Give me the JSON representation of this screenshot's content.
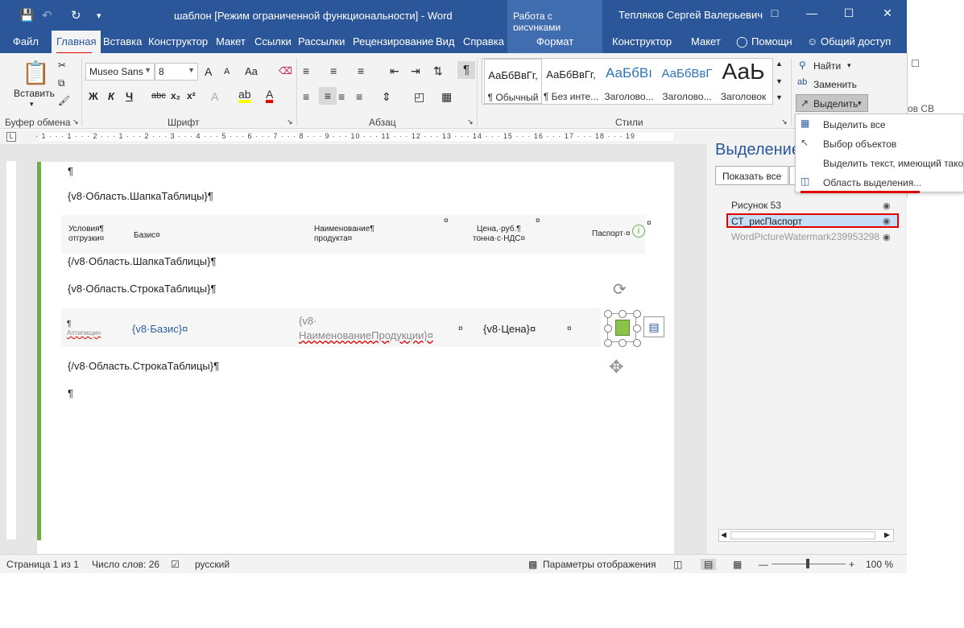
{
  "titlebar": {
    "save_icon": "save-icon",
    "title": "шаблон [Режим ограниченной функциональности]  -  Word",
    "context_header": "Работа с рисунками",
    "user": "Тепляков Сергей Валерьевич"
  },
  "tabs": {
    "file": "Файл",
    "home": "Главная",
    "insert": "Вставка",
    "design": "Конструктор",
    "layout": "Макет",
    "references": "Ссылки",
    "mailings": "Рассылки",
    "review": "Рецензирование",
    "view": "Вид",
    "help": "Справка",
    "format": "Формат",
    "design2": "Конструктор",
    "layout2": "Макет",
    "tellme": "Помощн",
    "share": "Общий доступ"
  },
  "ribbon": {
    "clipboard": {
      "paste": "Вставить",
      "label": "Буфер обмена"
    },
    "font": {
      "family": "Museo Sans",
      "size": "8",
      "bold": "Ж",
      "italic": "К",
      "underline": "Ч",
      "strike": "abc",
      "sub": "x₂",
      "sup": "x²",
      "grow": "A",
      "shrink": "A",
      "case": "Aa",
      "label": "Шрифт"
    },
    "paragraph": {
      "label": "Абзац"
    },
    "styles": {
      "items": [
        {
          "preview": "АаБбВвГг,",
          "name": "¶ Обычный"
        },
        {
          "preview": "АаБбВвГг,",
          "name": "¶ Без инте..."
        },
        {
          "preview": "АаБбВı",
          "name": "Заголово..."
        },
        {
          "preview": "АаБбВвГ",
          "name": "Заголово..."
        },
        {
          "preview": "АаЬ",
          "name": "Заголовок"
        }
      ],
      "label": "Стили"
    },
    "editing": {
      "find": "Найти",
      "replace": "Заменить",
      "select": "Выделить"
    }
  },
  "select_menu": {
    "items": [
      {
        "label": "Выделить все"
      },
      {
        "label": "Выбор объектов"
      },
      {
        "label": "Выделить текст, имеющий тако"
      },
      {
        "label": "Область выделения..."
      }
    ]
  },
  "ruler": {
    "marks": "· 1 · · · 1 · · · 2 · · · 1 · · · 2 · · · 3 · · · 4 · · · 5 · · · 6 · · · 7 · · · 8 · · · 9 · · · 10 · · · 11 · · · 12 · · · 13 · · · 14 · · · 15 · · · 16 · · · 17 · · · 18 · · · 19"
  },
  "document": {
    "para1": "¶",
    "header_open": "{v8·Область.ШапкаТаблицы}¶",
    "col1": "Условия¶",
    "col1b": "отгрузки¤",
    "col2": "Базис¤",
    "col3": "Наименование¶",
    "col3b": "продукта¤",
    "col4": "Цена,·руб.¶",
    "col4b": "тонна·с·НДС¤",
    "col5": "Паспорт·¤",
    "header_close": "{/v8·Область.ШапкаТаблицы}¶",
    "row_open": "{v8·Область.СтрокаТаблицы}¶",
    "cell1": "¶",
    "cell1b": "Аптипищин",
    "cell2": "{v8·Базис}¤",
    "cell3": "{v8·",
    "cell3b": "НаименованиеПродукции}¤",
    "cell3c": "¤",
    "cell4": "{v8·Цена}¤",
    "cell4b": "¤",
    "row_close": "{/v8·Область.СтрокаТаблицы}¶",
    "para_end": "¶"
  },
  "pane": {
    "title": "Выделение",
    "show_all": "Показать все",
    "items": [
      {
        "label": "Рисунок 53"
      },
      {
        "label": "СТ_рисПаспорт"
      },
      {
        "label": "WordPictureWatermark239953298"
      }
    ]
  },
  "statusbar": {
    "page": "Страница 1 из 1",
    "words": "Число слов: 26",
    "lang": "русский",
    "display": "Параметры отображения",
    "zoom": "100 %"
  },
  "background_window": {
    "text": "ов СВ"
  },
  "colors": {
    "brand": "#2b579a",
    "highlight_red": "#e00000",
    "accent_green": "#70ad47"
  }
}
